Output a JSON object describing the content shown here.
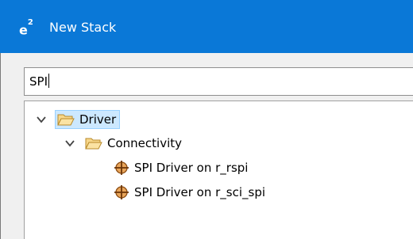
{
  "window": {
    "app_icon_text": "e",
    "app_icon_sup": "2",
    "title": "New Stack"
  },
  "filter": {
    "value": "SPI"
  },
  "tree": {
    "root": {
      "label": "Driver",
      "expanded": true,
      "selected": true
    },
    "category": {
      "label": "Connectivity",
      "expanded": true
    },
    "items": [
      {
        "label": "SPI Driver on r_rspi"
      },
      {
        "label": "SPI Driver on r_sci_spi"
      }
    ]
  },
  "colors": {
    "titlebar": "#0a78d7",
    "folder_fill": "#f7d78a",
    "folder_stroke": "#b88a2a",
    "component_fill": "#b5651d",
    "selection": "#cce8ff"
  }
}
